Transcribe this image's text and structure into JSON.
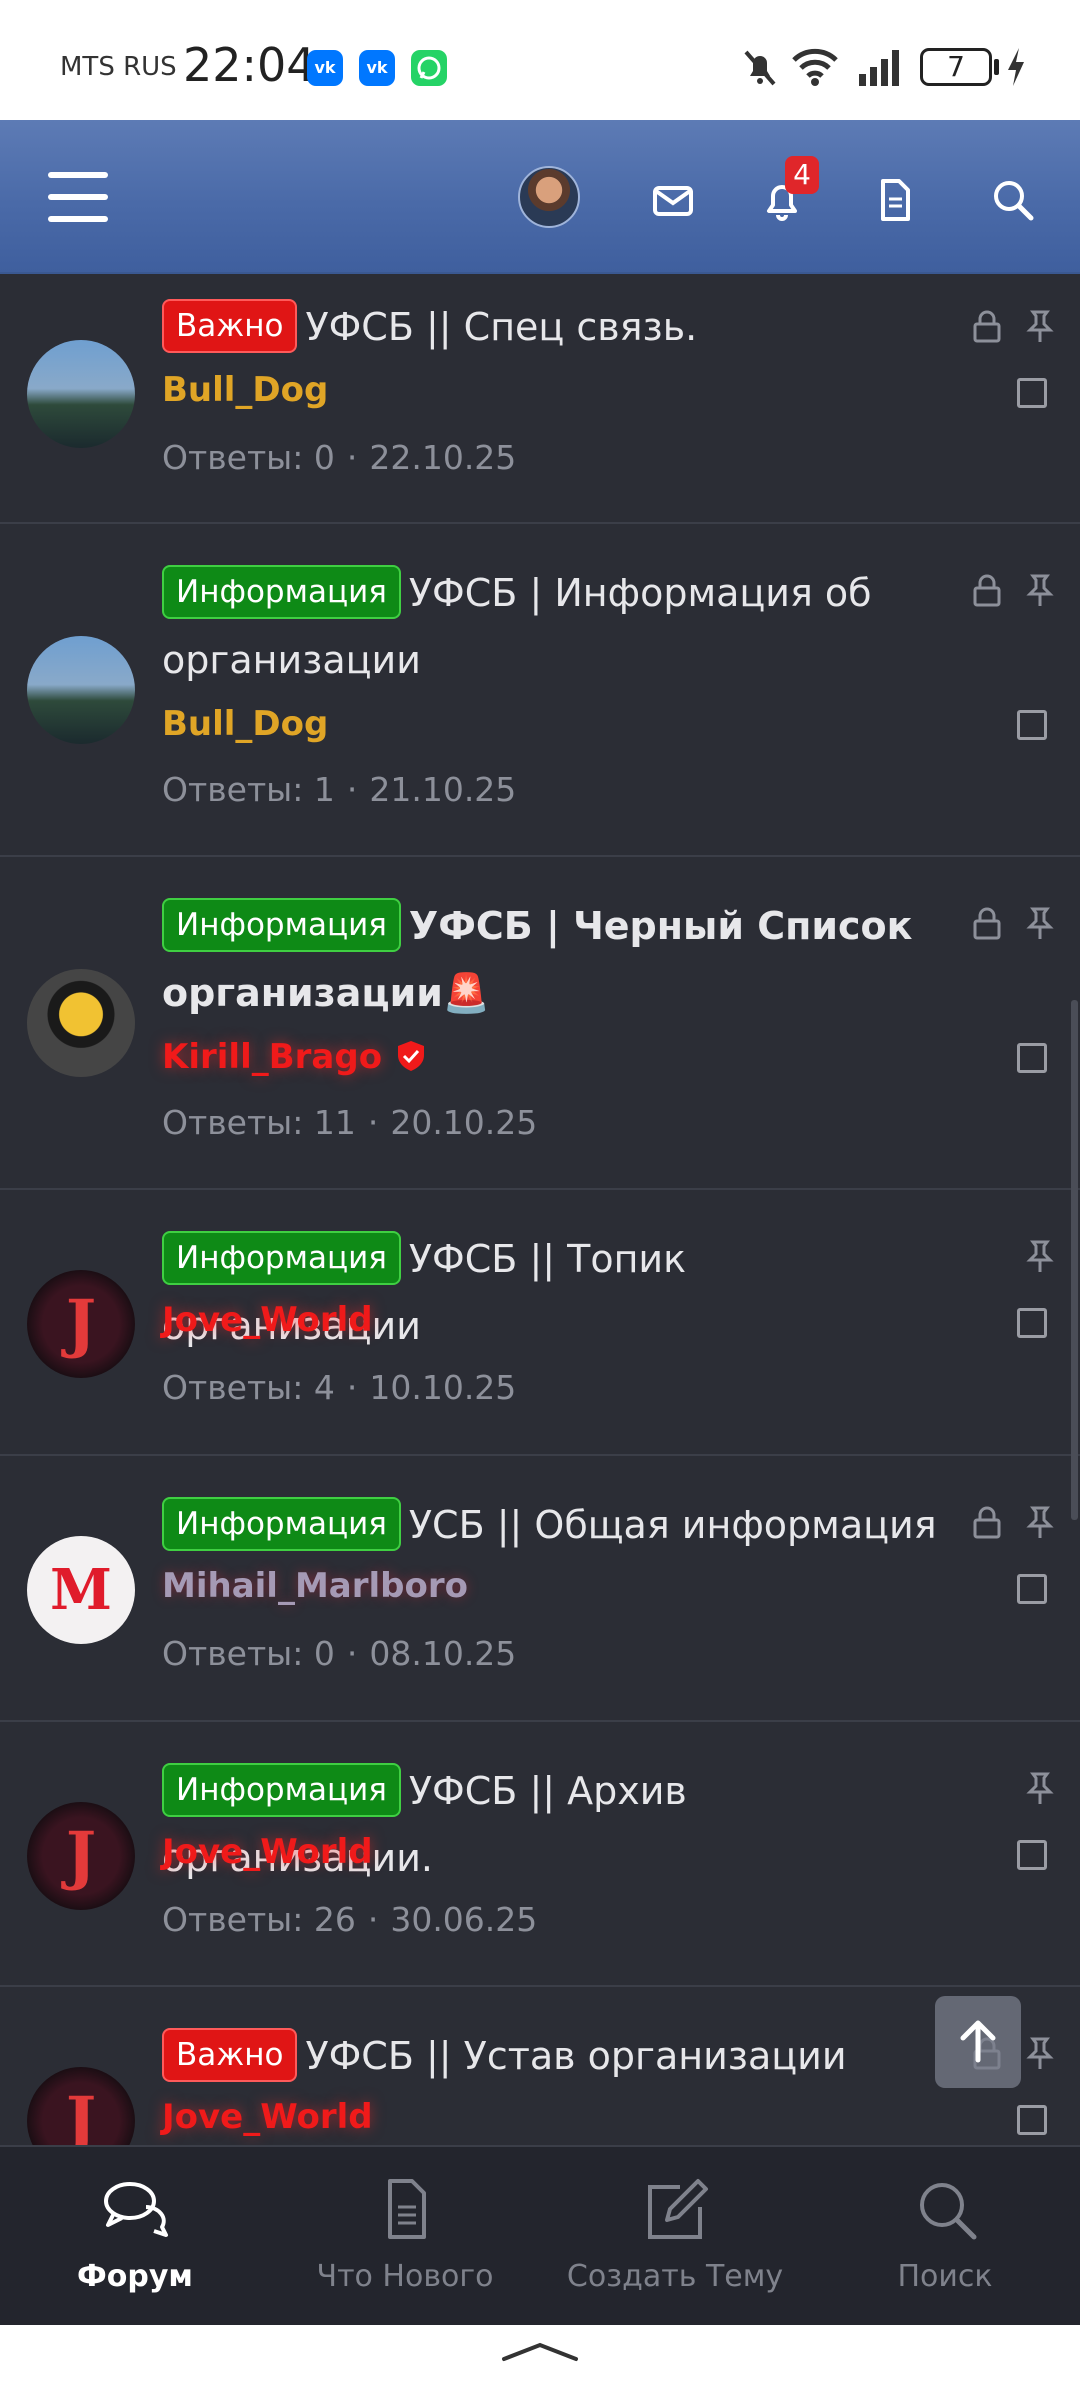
{
  "status_bar": {
    "carrier": "MTS RUS",
    "time": "22:04",
    "apps": [
      "vk-icon",
      "vk-icon",
      "whatsapp-icon"
    ],
    "battery": "7"
  },
  "header": {
    "notification_count": "4",
    "icons": [
      "menu-icon",
      "avatar",
      "mail-icon",
      "bell-icon",
      "document-icon",
      "search-icon"
    ]
  },
  "threads": [
    {
      "prefix": "Важно",
      "prefix_color": "#e01515",
      "title": "УФСБ || Спец связь.",
      "author": "Bull_Dog",
      "meta_label": "Ответы: 0",
      "date": "22.10.25",
      "locked": true,
      "pinned": true
    },
    {
      "prefix": "Информация",
      "prefix_color": "#0e8a16",
      "title_line1": "УФСБ | Информация об",
      "title_line2": "организации",
      "author": "Bull_Dog",
      "meta_label": "Ответы: 1",
      "date": "21.10.25",
      "locked": true,
      "pinned": true
    },
    {
      "prefix": "Информация",
      "prefix_color": "#0e8a16",
      "title_line1": "УФСБ | Черный Список",
      "title_line2": "организации🚨",
      "author": "Kirill_Brago",
      "meta_label": "Ответы: 11",
      "date": "20.10.25",
      "locked": true,
      "pinned": true
    },
    {
      "prefix": "Информация",
      "prefix_color": "#0e8a16",
      "title": "УФСБ || Топик организации",
      "author": "Jove_World",
      "meta_label": "Ответы: 4",
      "date": "10.10.25",
      "locked": false,
      "pinned": true
    },
    {
      "prefix": "Информация",
      "prefix_color": "#0e8a16",
      "title": "УСБ || Общая информация",
      "author": "Mihail_Marlboro",
      "meta_label": "Ответы: 0",
      "date": "08.10.25",
      "locked": true,
      "pinned": true
    },
    {
      "prefix": "Информация",
      "prefix_color": "#0e8a16",
      "title": "УФСБ || Архив организации.",
      "author": "Jove_World",
      "meta_label": "Ответы: 26",
      "date": "30.06.25",
      "locked": false,
      "pinned": true
    },
    {
      "prefix": "Важно",
      "prefix_color": "#e01515",
      "title": "УФСБ || Устав организации",
      "author": "Jove_World",
      "locked": true,
      "pinned": true
    }
  ],
  "bottom_nav": [
    {
      "label": "Форум",
      "icon": "chat-bubbles-icon",
      "active": true
    },
    {
      "label": "Что Нового",
      "icon": "document-icon",
      "active": false
    },
    {
      "label": "Создать Тему",
      "icon": "edit-icon",
      "active": false
    },
    {
      "label": "Поиск",
      "icon": "search-icon",
      "active": false
    }
  ],
  "colors": {
    "background": "#2b2d35",
    "header": "#4a6aa8",
    "author_gold": "#e0a526",
    "author_red": "#f01a1a"
  }
}
